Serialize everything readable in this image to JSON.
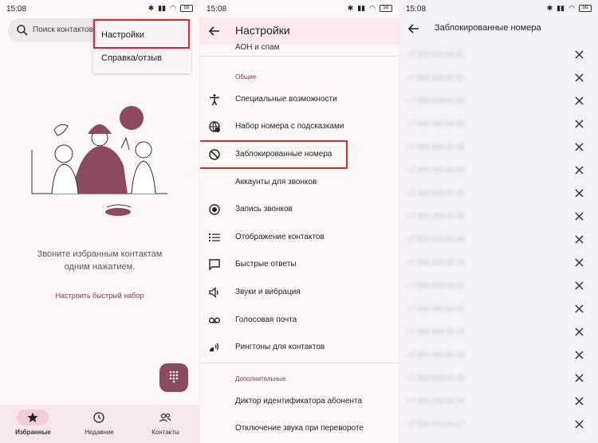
{
  "panel1": {
    "status": {
      "time": "15:08",
      "battery": "56"
    },
    "search_placeholder": "Поиск контактов",
    "menu": {
      "item1": "Настройки",
      "item2": "Справка/отзыв"
    },
    "empty_text": "Звоните избранным контактам одним нажатием.",
    "quick_dial": "Настроить быстрый набор",
    "nav": {
      "favorites": "Избранные",
      "recent": "Недавние",
      "contacts": "Контакты"
    },
    "accent": "#8b4a5e",
    "highlight": "#d92b2b"
  },
  "panel2": {
    "status": {
      "time": "15:08",
      "battery": "56"
    },
    "title": "Настройки",
    "cutoff_item": "АОН и спам",
    "section_general": "Общие",
    "items": [
      {
        "label": "Специальные возможности",
        "icon": "accessibility-icon"
      },
      {
        "label": "Набор номера с подсказками",
        "icon": "assisted-dial-icon"
      },
      {
        "label": "Заблокированные номера",
        "icon": "block-icon"
      },
      {
        "label": "Аккаунты для звонков",
        "icon": ""
      },
      {
        "label": "Запись звонков",
        "icon": "record-icon"
      },
      {
        "label": "Отображение контактов",
        "icon": "list-icon"
      },
      {
        "label": "Быстрые ответы",
        "icon": "message-icon"
      },
      {
        "label": "Звуки и вибрация",
        "icon": "volume-icon"
      },
      {
        "label": "Голосовая почта",
        "icon": "voicemail-icon"
      },
      {
        "label": "Рингтоны для контактов",
        "icon": "ringtone-icon"
      }
    ],
    "section_additional": "Дополнительные",
    "extra_items": [
      {
        "label": "Диктор идентификатора абонента"
      },
      {
        "label": "Отключение звука при перевороте"
      }
    ]
  },
  "panel3": {
    "status": {
      "time": "15:08",
      "battery": "56"
    },
    "title": "Заблокированные номера",
    "numbers": [
      "+7 900 000-00-01",
      "+7 900 000-00-02",
      "+7 900 000-00-03",
      "+7 900 000-00-04",
      "+7 900 000-00-05",
      "+7 900 000-00-06",
      "+7 900 000-00-07",
      "+7 900 000-00-08",
      "+7 900 000-00-09",
      "+7 900 000-00-10",
      "+7 900 000-00-11",
      "+7 900 000-00-12",
      "+7 900 000-00-13",
      "+7 900 000-00-14",
      "+7 900 000-00-15",
      "+7 900 000-00-16",
      "+7 900 000-00-17"
    ]
  }
}
